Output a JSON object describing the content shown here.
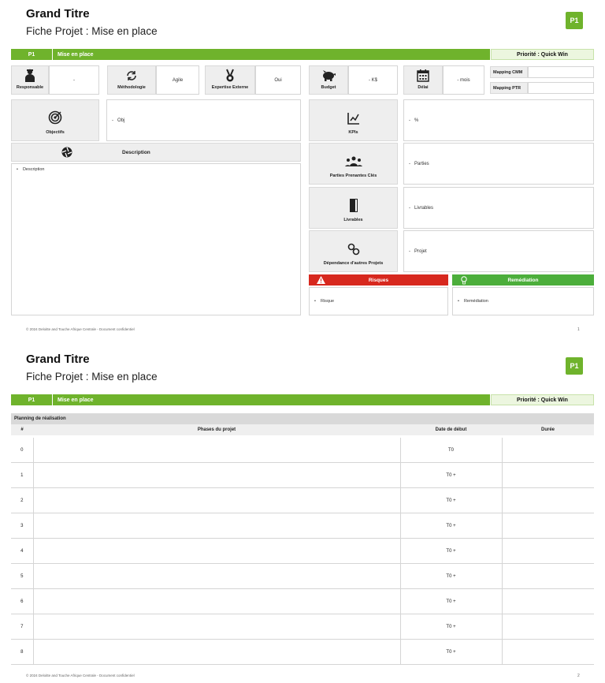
{
  "slide1": {
    "title": "Grand Titre",
    "subtitle": "Fiche Projet : Mise en place",
    "badge": "P1",
    "bar": {
      "code": "P1",
      "name": "Mise en place",
      "priority": "Priorité : Quick Win"
    },
    "row1": {
      "responsable": {
        "label": "Responsable",
        "value": "-"
      },
      "methodologie": {
        "label": "Méthodologie",
        "value": "Agile"
      },
      "expertise": {
        "label": "Expertise Externe",
        "value": "Oui"
      },
      "budget": {
        "label": "Budget",
        "value": "- K$"
      },
      "delai": {
        "label": "Délai",
        "value": "- mois"
      },
      "mapping_cmm": "Mapping CMM",
      "mapping_ptr": "Mapping PTR"
    },
    "objectifs": {
      "label": "Objectifs",
      "value": "Obj"
    },
    "description": {
      "header": "Description",
      "item": "Description"
    },
    "kpis": {
      "label": "KPIs",
      "value": "%"
    },
    "parties": {
      "label": "Parties Prenantes Clés",
      "value": "Parties"
    },
    "livrables": {
      "label": "Livrables",
      "value": "Livrables"
    },
    "dependance": {
      "label": "Dépendance d'autres Projets",
      "value": "Projet"
    },
    "risques": {
      "header": "Risques",
      "item": "Risque"
    },
    "remediation": {
      "header": "Remédiation",
      "item": "Remédiation"
    },
    "footer": "© 2024 Deloitte and Touche Afrique Centrale - Document confidentiel",
    "page": "1"
  },
  "slide2": {
    "title": "Grand Titre",
    "subtitle": "Fiche Projet : Mise en place",
    "badge": "P1",
    "bar": {
      "code": "P1",
      "name": "Mise en place",
      "priority": "Priorité : Quick Win"
    },
    "planning_title": "Planning de réalisation",
    "headers": {
      "num": "#",
      "phases": "Phases du projet",
      "date": "Date de début",
      "duree": "Durée"
    },
    "rows": [
      {
        "num": "0",
        "date": "T0"
      },
      {
        "num": "1",
        "date": "T0 +"
      },
      {
        "num": "2",
        "date": "T0 +"
      },
      {
        "num": "3",
        "date": "T0 +"
      },
      {
        "num": "4",
        "date": "T0 +"
      },
      {
        "num": "5",
        "date": "T0 +"
      },
      {
        "num": "6",
        "date": "T0 +"
      },
      {
        "num": "7",
        "date": "T0 +"
      },
      {
        "num": "8",
        "date": "T0 +"
      }
    ],
    "footer": "© 2024 Deloitte and Touche Afrique Centrale - Document confidentiel",
    "page": "2"
  },
  "colors": {
    "green": "#6fb32c",
    "light_green": "#ecf6df",
    "red": "#d7281e",
    "remediation_green": "#4cae3b"
  },
  "icons": [
    "person-icon",
    "cycle-icon",
    "medal-icon",
    "piggy-bank-icon",
    "calendar-icon",
    "target-icon",
    "aperture-icon",
    "chart-icon",
    "group-icon",
    "book-icon",
    "link-icon",
    "warning-icon",
    "lightbulb-icon"
  ]
}
